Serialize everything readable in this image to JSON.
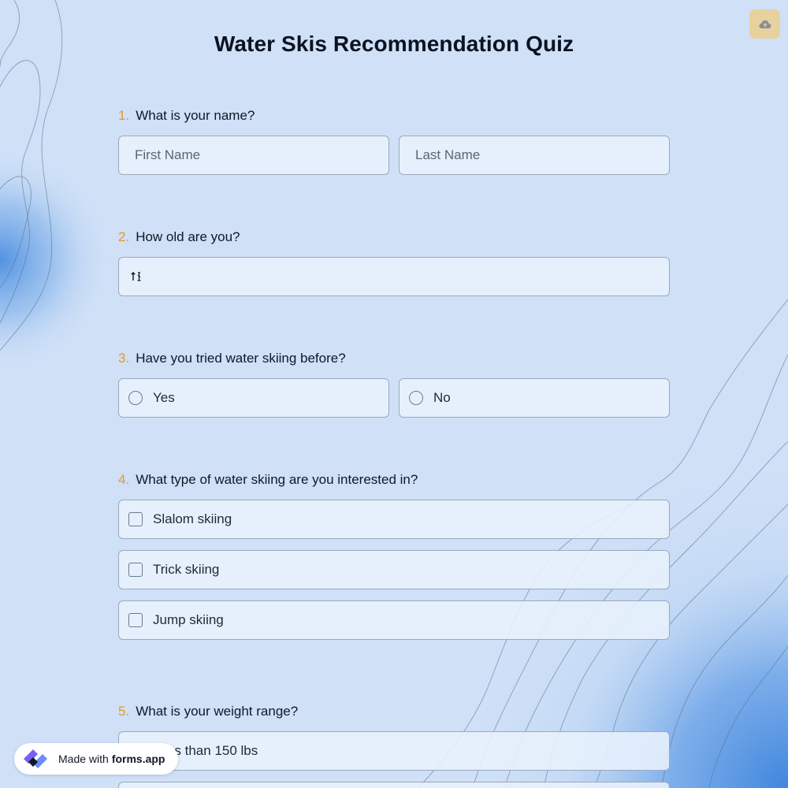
{
  "header": {
    "title": "Water Skis Recommendation Quiz",
    "cloud_icon": "cloud-upload-icon"
  },
  "questions": [
    {
      "number": "1.",
      "text": "What is your name?",
      "inputs": [
        {
          "placeholder": "First Name"
        },
        {
          "placeholder": "Last Name"
        }
      ]
    },
    {
      "number": "2.",
      "text": "How old are you?",
      "input_icon": "sort-arrows-icon",
      "value": ""
    },
    {
      "number": "3.",
      "text": "Have you tried water skiing before?",
      "options": [
        "Yes",
        "No"
      ]
    },
    {
      "number": "4.",
      "text": "What type of water skiing are you interested in?",
      "options": [
        "Slalom skiing",
        "Trick skiing",
        "Jump skiing"
      ]
    },
    {
      "number": "5.",
      "text": "What is your weight range?",
      "options": [
        "Less than 150 lbs"
      ],
      "visible_partial": "s than 150 lbs"
    }
  ],
  "footer_badge": {
    "prefix": "Made with",
    "brand": "forms.app",
    "icon": "forms-app-logo-icon"
  },
  "colors": {
    "background": "#cfe0f7",
    "accent_number": "#e69a21",
    "cloud_button": "#e7d29e"
  }
}
